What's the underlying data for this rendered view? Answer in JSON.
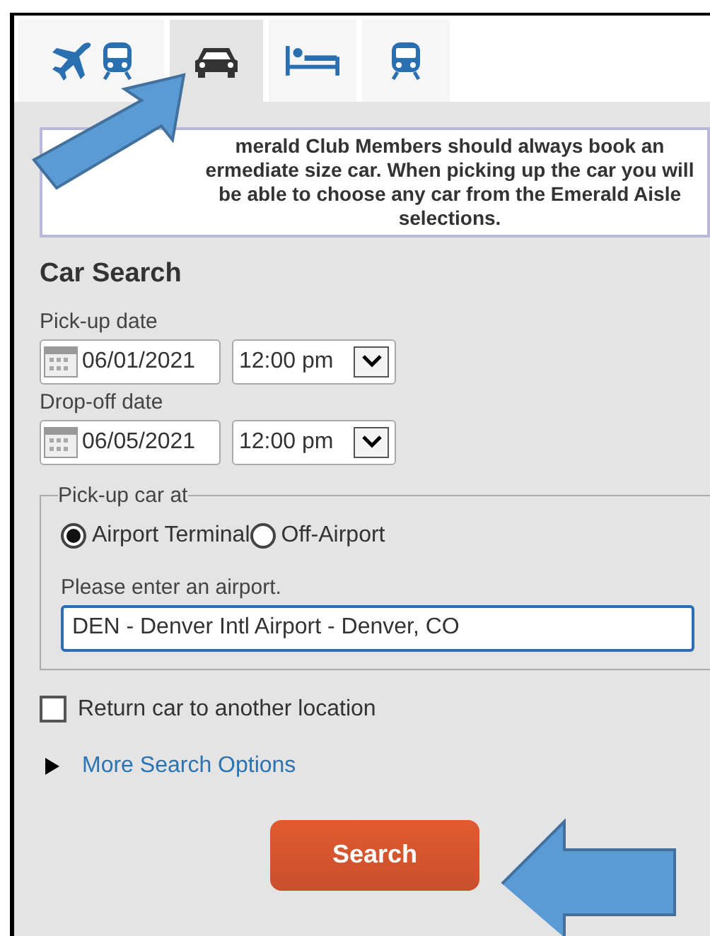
{
  "tabs": [
    {
      "kind": "air-rail",
      "selected": false
    },
    {
      "kind": "car",
      "selected": true
    },
    {
      "kind": "hotel",
      "selected": false
    },
    {
      "kind": "rail",
      "selected": false
    }
  ],
  "notice": "merald Club Members should always book an ermediate size car. When picking up the car you will be able to choose any car from the Emerald Aisle selections.",
  "heading": "Car Search",
  "dates": [
    {
      "label": "Pick-up date",
      "date": "06/01/2021",
      "time": "12:00 pm"
    },
    {
      "label": "Drop-off date",
      "date": "06/05/2021",
      "time": "12:00 pm"
    }
  ],
  "pickup": {
    "legend": "Pick-up car at",
    "options": [
      {
        "label": "Airport Terminal",
        "selected": true
      },
      {
        "label": "Off-Airport",
        "selected": false
      }
    ],
    "airport_label": "Please enter an airport.",
    "airport_value": "DEN - Denver Intl Airport - Denver, CO"
  },
  "return_other": {
    "label": "Return car to another location",
    "checked": false
  },
  "more_options": {
    "label": "More Search Options",
    "expanded": false
  },
  "search_button": "Search"
}
